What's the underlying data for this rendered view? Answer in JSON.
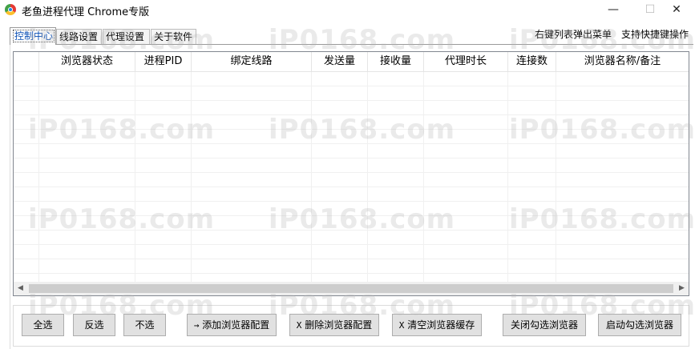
{
  "window": {
    "title": "老鱼进程代理 Chrome专版",
    "min_glyph": "—",
    "max_glyph": "☐",
    "close_glyph": "✕"
  },
  "tabs": [
    {
      "label": "控制中心",
      "active": true
    },
    {
      "label": "线路设置",
      "active": false
    },
    {
      "label": "代理设置",
      "active": false
    },
    {
      "label": "关于软件",
      "active": false
    }
  ],
  "hints": {
    "right_click": "右键列表弹出菜单",
    "shortcuts": "支持快捷键操作"
  },
  "table": {
    "columns": [
      "",
      "浏览器状态",
      "进程PID",
      "绑定线路",
      "发送量",
      "接收量",
      "代理时长",
      "连接数",
      "浏览器名称/备注"
    ],
    "rows": []
  },
  "scrollbar": {
    "left_glyph": "◀",
    "right_glyph": "▶"
  },
  "buttons": {
    "select_all": "全选",
    "invert": "反选",
    "select_none": "不选",
    "add_symbol": "→",
    "add_config": "添加浏览器配置",
    "delete_symbol": "X",
    "delete_config": "删除浏览器配置",
    "clear_symbol": "X",
    "clear_cache": "清空浏览器缓存",
    "close_checked": "关闭勾选浏览器",
    "start_checked": "启动勾选浏览器"
  },
  "watermark": {
    "text": "iP0168.com"
  }
}
